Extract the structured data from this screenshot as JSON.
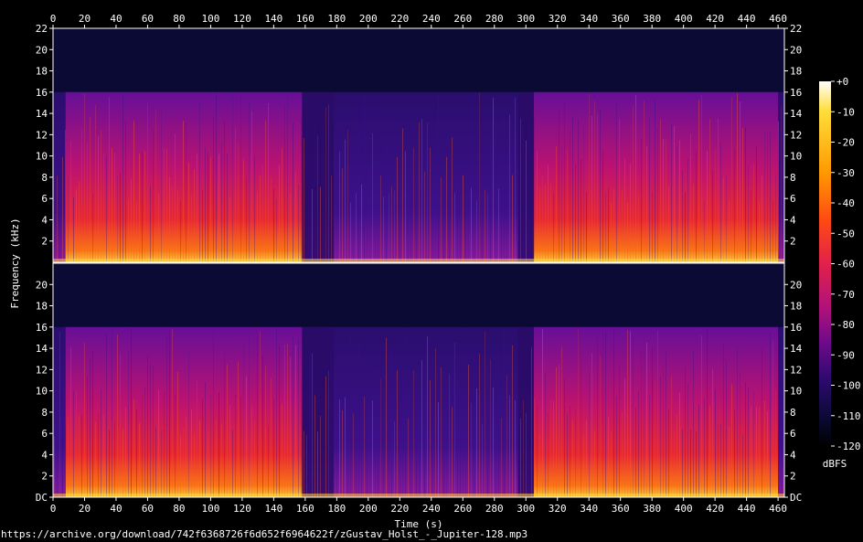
{
  "chart_data": {
    "type": "heatmap",
    "title": "",
    "xlabel": "Time (s)",
    "ylabel": "Frequency (kHz)",
    "colorbar_label": "dBFS",
    "xlim": [
      0,
      464
    ],
    "ylim": [
      0,
      22
    ],
    "x_ticks": [
      "0",
      "20",
      "40",
      "60",
      "80",
      "100",
      "120",
      "140",
      "160",
      "180",
      "200",
      "220",
      "240",
      "260",
      "280",
      "300",
      "320",
      "340",
      "360",
      "380",
      "400",
      "420",
      "440",
      "460"
    ],
    "y_ticks_upper": [
      "2",
      "4",
      "6",
      "8",
      "10",
      "12",
      "14",
      "16",
      "18",
      "20",
      "22"
    ],
    "y_ticks_lower": [
      "DC",
      "2",
      "4",
      "6",
      "8",
      "10",
      "12",
      "14",
      "16",
      "18",
      "20"
    ],
    "colorbar_ticks": [
      "+0",
      "-10",
      "-20",
      "-30",
      "-40",
      "-50",
      "-60",
      "-70",
      "-80",
      "-90",
      "-100",
      "-110",
      "-120"
    ],
    "channels": 2,
    "lowpass_cutoff_khz": 16,
    "loud_segments_s": [
      [
        8,
        158
      ],
      [
        305,
        460
      ]
    ],
    "quiet_segments_s": [
      [
        158,
        178
      ],
      [
        295,
        305
      ]
    ],
    "colors": {
      "background": "#000000",
      "axis": "#ffffff",
      "colormap": [
        "#000000",
        "#0b0a35",
        "#2c0a6e",
        "#6b0a8a",
        "#b0127a",
        "#e3204b",
        "#ff4a14",
        "#ff9a00",
        "#ffdf3a",
        "#ffffff"
      ]
    }
  },
  "footer": {
    "source_url": "https://archive.org/download/742f6368726f6d652f6964622f/zGustav_Holst_-_Jupiter-128.mp3"
  }
}
